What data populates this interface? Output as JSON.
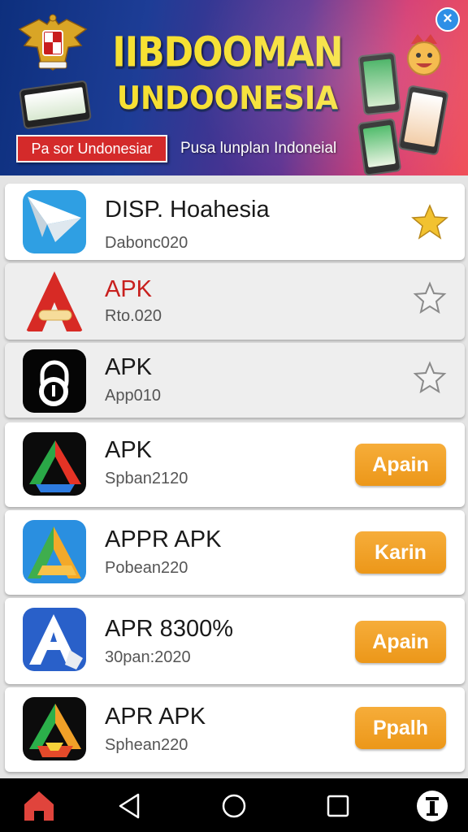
{
  "banner": {
    "title": "IIBDOOMAN",
    "subtitle": "UNDOONESIA",
    "chip_label": "Pa sor Undonesiar",
    "tagline": "Pusa lunplan Indoneial"
  },
  "apps": [
    {
      "name": "DISP. Hoahesia",
      "sub": "Dabonc020",
      "action": "star",
      "starred": true,
      "icon": "paper-plane-icon"
    },
    {
      "name": "APK",
      "sub": "Rto.020",
      "action": "star",
      "starred": false,
      "icon": "red-a-icon"
    },
    {
      "name": "APK",
      "sub": "App010",
      "action": "star",
      "starred": false,
      "icon": "padlock-icon"
    },
    {
      "name": "APK",
      "sub": "Spban2120",
      "action": "button",
      "button_label": "Apain",
      "icon": "triangle-a-icon"
    },
    {
      "name": "APPR APK",
      "sub": "Pobean220",
      "action": "button",
      "button_label": "Karin",
      "icon": "green-a-icon"
    },
    {
      "name": "APR 8300%",
      "sub": "30pan:2020",
      "action": "button",
      "button_label": "Apain",
      "icon": "blue-a-icon"
    },
    {
      "name": "APR APK",
      "sub": "Sphean220",
      "action": "button",
      "button_label": "Ppalh",
      "icon": "drive-icon"
    }
  ],
  "colors": {
    "accent_orange": "#f0a028",
    "star_gold": "#f2c230",
    "title_red": "#c8201e",
    "nav_home_red": "#e0443c"
  }
}
